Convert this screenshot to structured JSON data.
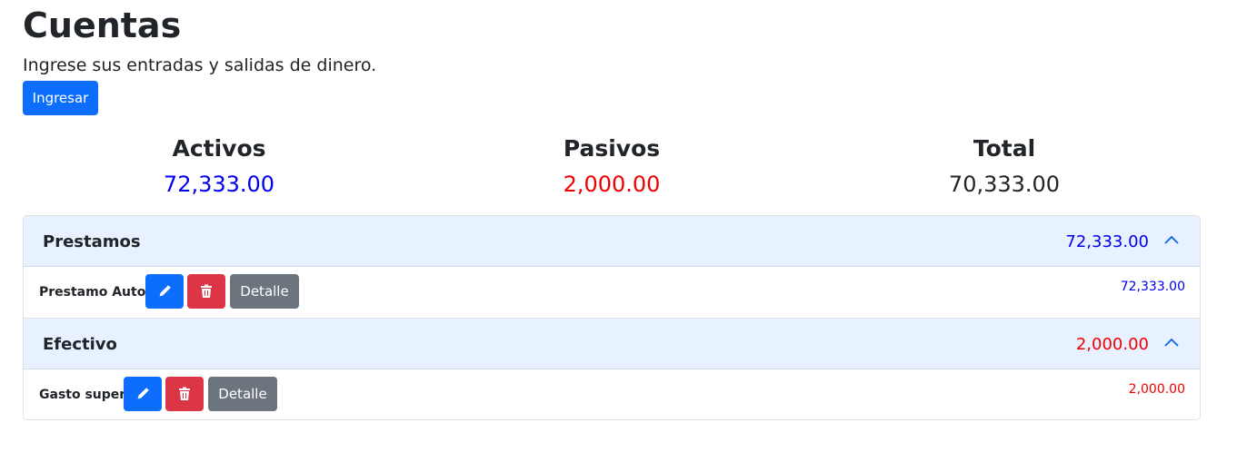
{
  "page": {
    "title": "Cuentas",
    "subtitle": "Ingrese sus entradas y salidas de dinero.",
    "ingresar_label": "Ingresar"
  },
  "summary": {
    "activos": {
      "label": "Activos",
      "value": "72,333.00"
    },
    "pasivos": {
      "label": "Pasivos",
      "value": "2,000.00"
    },
    "total": {
      "label": "Total",
      "value": "70,333.00"
    }
  },
  "colors": {
    "positive": "#0000ee",
    "negative": "#ee0000",
    "primary": "#0d6efd",
    "danger": "#dc3545",
    "secondary": "#6c757d"
  },
  "accounts": [
    {
      "name": "Prestamos",
      "amount": "72,333.00",
      "items": [
        {
          "name": "Prestamo Auto",
          "amount": "72,333.00",
          "edit_icon": "pencil-icon",
          "delete_icon": "trash-icon",
          "detail_label": "Detalle"
        }
      ]
    },
    {
      "name": "Efectivo",
      "amount": "2,000.00",
      "items": [
        {
          "name": "Gasto super",
          "amount": "2,000.00",
          "edit_icon": "pencil-icon",
          "delete_icon": "trash-icon",
          "detail_label": "Detalle"
        }
      ]
    }
  ]
}
